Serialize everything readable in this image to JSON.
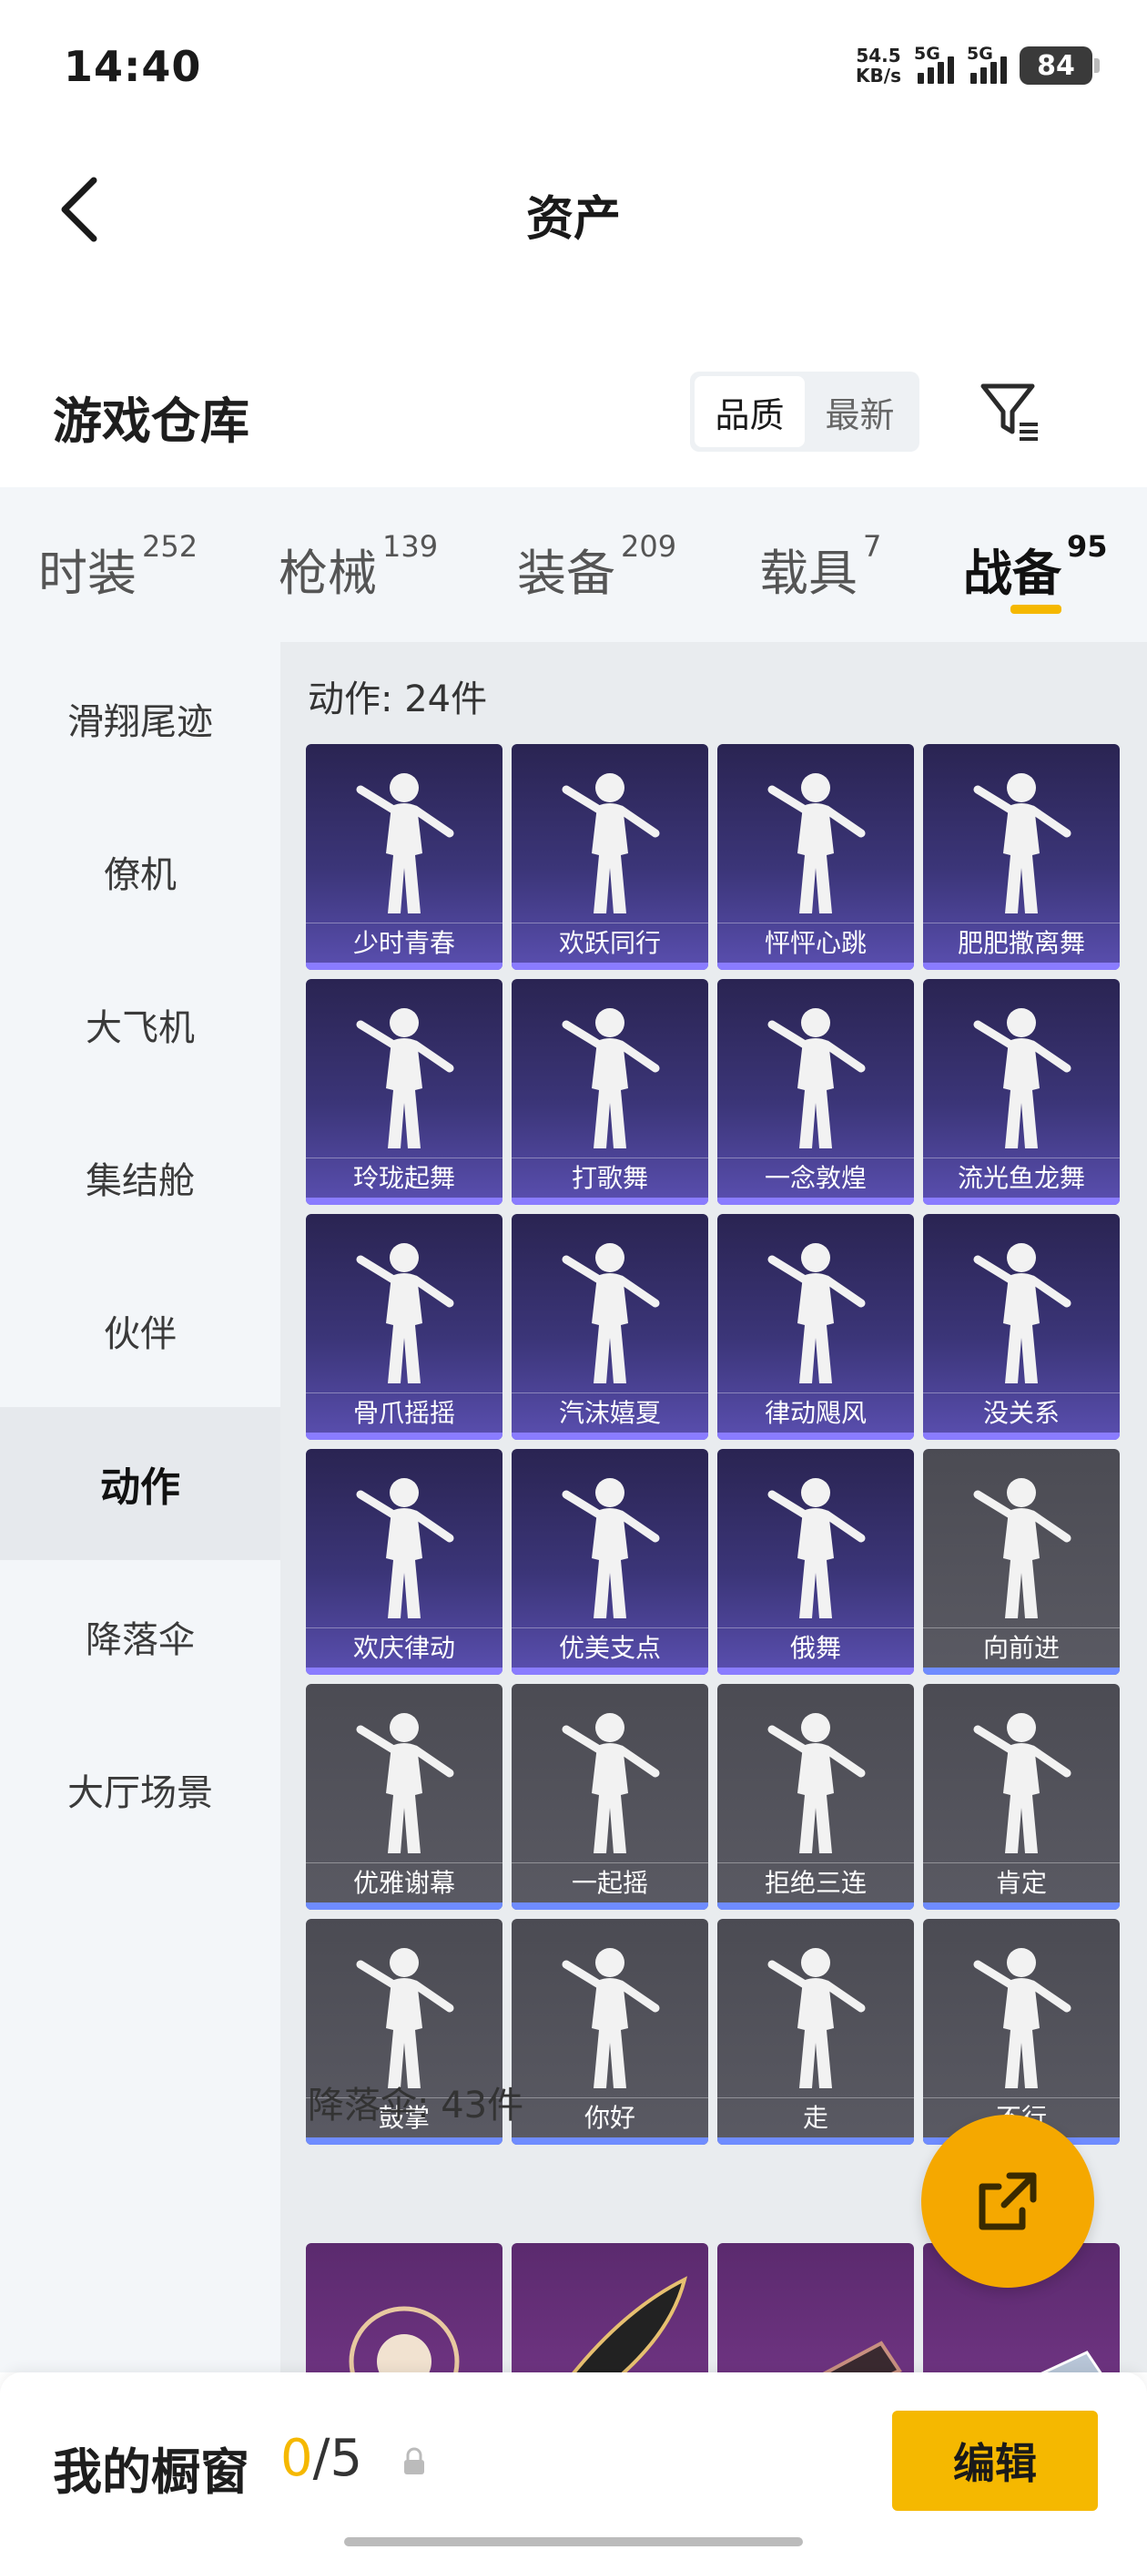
{
  "status": {
    "time": "14:40",
    "speed": "54.5",
    "speed_unit": "KB/s",
    "net1": "5G",
    "net2": "5G",
    "battery": "84"
  },
  "nav": {
    "title": "资产"
  },
  "warehouse": {
    "title": "游戏仓库",
    "sort_quality": "品质",
    "sort_newest": "最新"
  },
  "tabs": [
    {
      "label": "时装",
      "count": "252"
    },
    {
      "label": "枪械",
      "count": "139"
    },
    {
      "label": "装备",
      "count": "209"
    },
    {
      "label": "载具",
      "count": "7"
    },
    {
      "label": "战备",
      "count": "95"
    }
  ],
  "sidenav": [
    "滑翔尾迹",
    "僚机",
    "大飞机",
    "集结舱",
    "伙伴",
    "动作",
    "降落伞",
    "大厅场景"
  ],
  "sections": {
    "actions": {
      "title": "动作: 24件",
      "items": [
        "少时青春",
        "欢跃同行",
        "怦怦心跳",
        "肥肥撒离舞",
        "玲珑起舞",
        "打歌舞",
        "一念敦煌",
        "流光鱼龙舞",
        "骨爪摇摇",
        "汽沫嬉夏",
        "律动飓风",
        "没关系",
        "欢庆律动",
        "优美支点",
        "俄舞",
        "向前进",
        "优雅谢幕",
        "一起摇",
        "拒绝三连",
        "肯定",
        "鼓掌",
        "你好",
        "走",
        "不行"
      ]
    },
    "parachutes": {
      "title": "降落伞: 43件"
    }
  },
  "showcase": {
    "title": "我的橱窗",
    "current": "0",
    "sep_total": "/5",
    "edit_label": "编辑"
  },
  "colors": {
    "accent": "#f5b800",
    "fab": "#f5a800",
    "rare_purple": "#3b3578",
    "common_gray": "#55555d",
    "legend_magenta": "#7b3a8e"
  }
}
